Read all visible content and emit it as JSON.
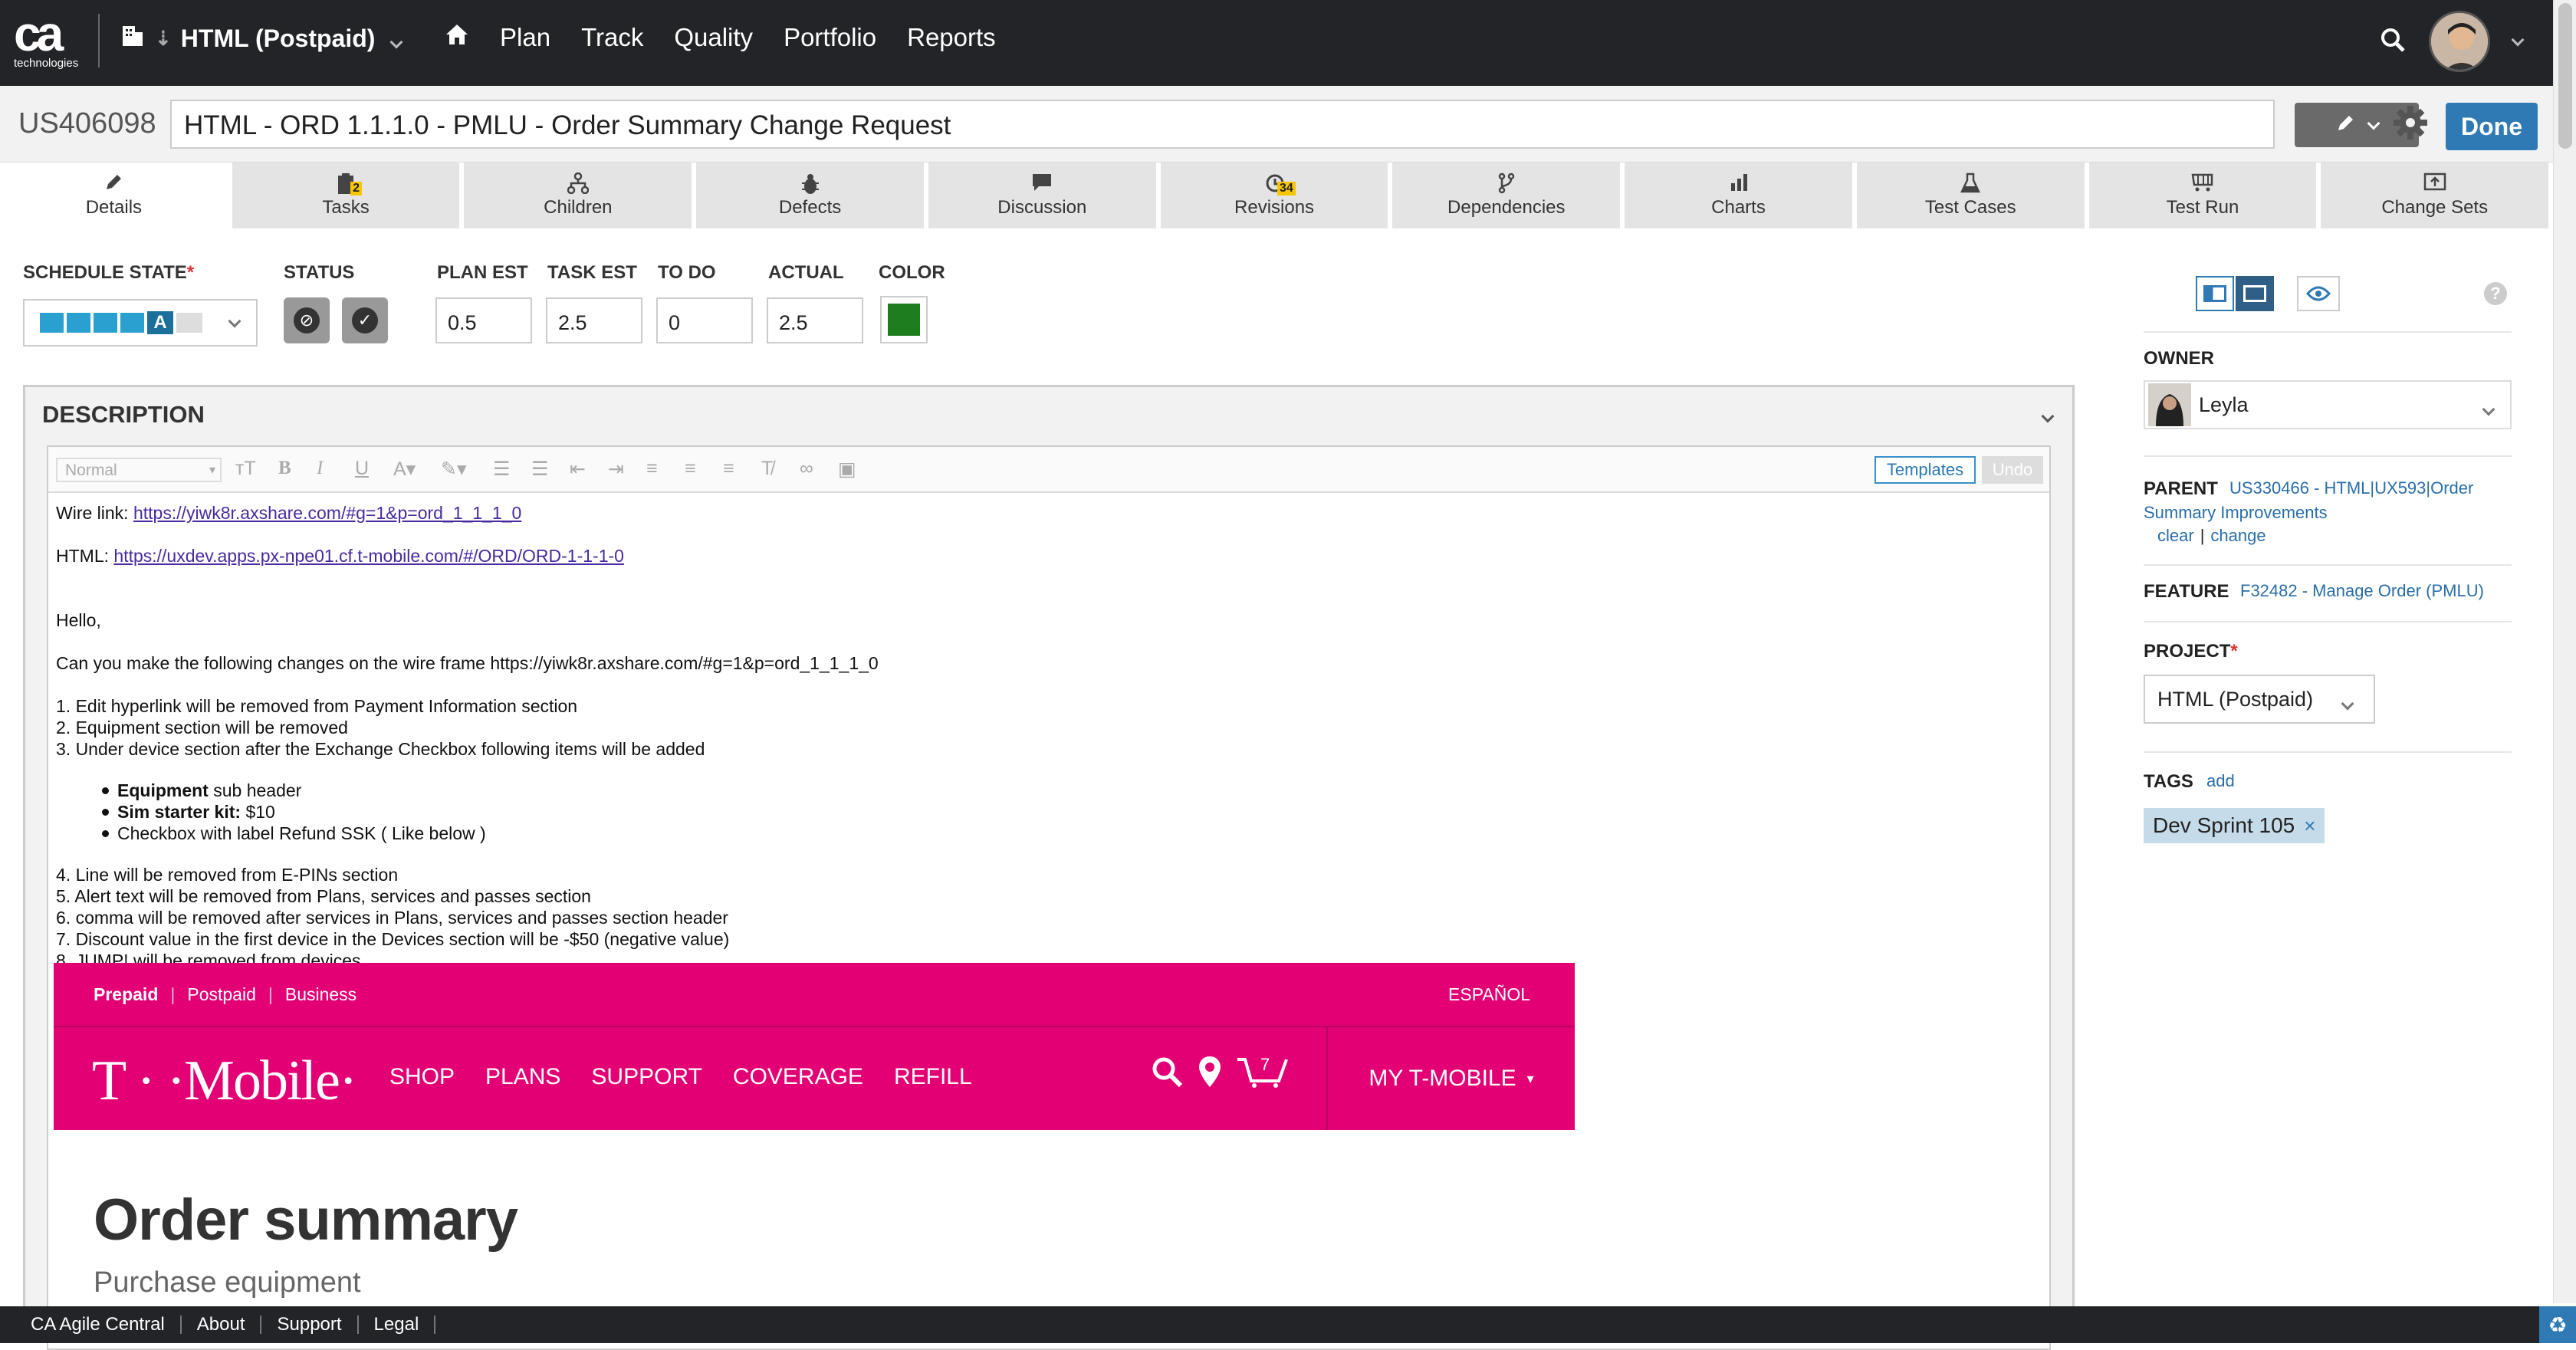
{
  "app": {
    "logo_main": "ca",
    "logo_sub": "technologies"
  },
  "topbar": {
    "project": "HTML (Postpaid)",
    "nav": [
      "Plan",
      "Track",
      "Quality",
      "Portfolio",
      "Reports"
    ]
  },
  "artifact": {
    "id": "US406098",
    "title": "HTML - ORD 1.1.1.0 - PMLU - Order Summary Change Request",
    "done_label": "Done"
  },
  "tabs": [
    {
      "label": "Details",
      "icon": "pencil-icon",
      "count": ""
    },
    {
      "label": "Tasks",
      "icon": "clipboard-icon",
      "count": "2"
    },
    {
      "label": "Children",
      "icon": "hierarchy-icon",
      "count": ""
    },
    {
      "label": "Defects",
      "icon": "bug-icon",
      "count": ""
    },
    {
      "label": "Discussion",
      "icon": "chat-icon",
      "count": ""
    },
    {
      "label": "Revisions",
      "icon": "history-icon",
      "count": "34"
    },
    {
      "label": "Dependencies",
      "icon": "branch-icon",
      "count": ""
    },
    {
      "label": "Charts",
      "icon": "bar-chart-icon",
      "count": ""
    },
    {
      "label": "Test Cases",
      "icon": "flask-icon",
      "count": ""
    },
    {
      "label": "Test Run",
      "icon": "cart-icon",
      "count": ""
    },
    {
      "label": "Change Sets",
      "icon": "upload-icon",
      "count": ""
    }
  ],
  "fields": {
    "schedule_state_label": "SCHEDULE STATE",
    "schedule_state_value": "A",
    "status_label": "STATUS",
    "plan_est_label": "PLAN EST",
    "plan_est": "0.5",
    "task_est_label": "TASK EST",
    "task_est": "2.5",
    "todo_label": "TO DO",
    "todo": "0",
    "actual_label": "ACTUAL",
    "actual": "2.5",
    "color_label": "COLOR",
    "color": "#1e7e1e"
  },
  "description": {
    "header": "DESCRIPTION",
    "style_select": "Normal",
    "templates_label": "Templates",
    "undo_label": "Undo",
    "wire_prefix": "Wire link: ",
    "wire_link": "https://yiwk8r.axshare.com/#g=1&p=ord_1_1_1_0",
    "html_prefix": "HTML: ",
    "html_link": "https://uxdev.apps.px-npe01.cf.t-mobile.com/#/ORD/ORD-1-1-1-0",
    "greeting": "Hello,",
    "intro": "Can you make the following changes on the wire frame https://yiwk8r.axshare.com/#g=1&p=ord_1_1_1_0",
    "items_a": [
      "1. Edit hyperlink will be removed from Payment Information section",
      "2. Equipment section will be removed",
      "3. Under device section after the Exchange Checkbox following items will be added"
    ],
    "bullets": [
      {
        "bold": "Equipment",
        "rest": " sub header"
      },
      {
        "bold": "Sim starter kit:",
        "rest": " $10"
      },
      {
        "bold": "",
        "rest": "Checkbox with label Refund SSK ( Like below )"
      }
    ],
    "items_b": [
      "4. Line will be removed from E-PINs section",
      "5. Alert text will be removed from Plans, services and passes section",
      "6. comma will be removed after services in Plans, services and passes section header",
      "7. Discount value in the first device in the Devices section will be -$50 (negative value)",
      "8. JUMP! will be removed from devices"
    ],
    "embed": {
      "top_links": [
        "Prepaid",
        "Postpaid",
        "Business"
      ],
      "espanol": "ESPAÑOL",
      "brand": "T · ·Mobile·",
      "menu": [
        "SHOP",
        "PLANS",
        "SUPPORT",
        "COVERAGE",
        "REFILL"
      ],
      "cart_count": "7",
      "my_tmobile": "MY T-MOBILE",
      "order_summary": "Order summary",
      "purchase_equipment": "Purchase equipment"
    }
  },
  "sidebar": {
    "owner_label": "OWNER",
    "owner": "Leyla",
    "parent_label": "PARENT",
    "parent_link_1": "US330466 - HTML|UX593|Order",
    "parent_link_2": "Summary Improvements",
    "clear": "clear",
    "sep": "|",
    "change": "change",
    "feature_label": "FEATURE",
    "feature_link": "F32482 - Manage Order (PMLU)",
    "project_label": "PROJECT",
    "project": "HTML (Postpaid)",
    "tags_label": "TAGS",
    "tags_add": "add",
    "tag": "Dev Sprint 105",
    "tag_remove": "×"
  },
  "footer": {
    "items": [
      "CA Agile Central",
      "About",
      "Support",
      "Legal"
    ]
  }
}
